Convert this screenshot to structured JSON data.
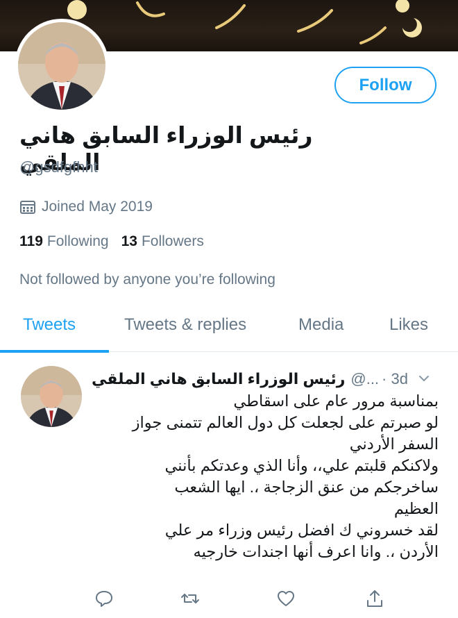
{
  "profile": {
    "follow_label": "Follow",
    "display_name": "رئيس الوزراء السابق هاني الملقي",
    "handle": "@gsdfgfhht",
    "joined": "Joined May 2019",
    "following_count": "119",
    "following_label": "Following",
    "followers_count": "13",
    "followers_label": "Followers",
    "not_followed_text": "Not followed by anyone you’re following"
  },
  "tabs": [
    {
      "label": "Tweets",
      "active": true
    },
    {
      "label": "Tweets & replies",
      "active": false
    },
    {
      "label": "Media",
      "active": false
    },
    {
      "label": "Likes",
      "active": false
    }
  ],
  "tweet": {
    "name": "رئيس الوزراء السابق هاني الملقي",
    "handle": "@...",
    "time": "· 3d",
    "lines": [
      "بمناسبة مرور عام على اسقاطي",
      "لو صبرتم على لجعلت كل دول العالم تتمنى جواز",
      "السفر الأردني",
      "ولاكنكم قلبتم علي،، وأنا الذي وعدتكم بأنني",
      "ساخرجكم من عنق الزجاجة ،. ايها الشعب",
      "العظيم",
      "لقد خسروني ك افضل رئيس وزراء مر علي",
      "الأردن ،. وانا اعرف أنها اجندات خارجيه"
    ]
  },
  "icons": {
    "calendar": "calendar-icon",
    "chevron": "chevron-down-icon",
    "reply": "reply-icon",
    "retweet": "retweet-icon",
    "like": "heart-icon",
    "share": "share-icon"
  },
  "colors": {
    "accent": "#1da1f2",
    "secondary_text": "#657786",
    "primary_text": "#14171a"
  }
}
